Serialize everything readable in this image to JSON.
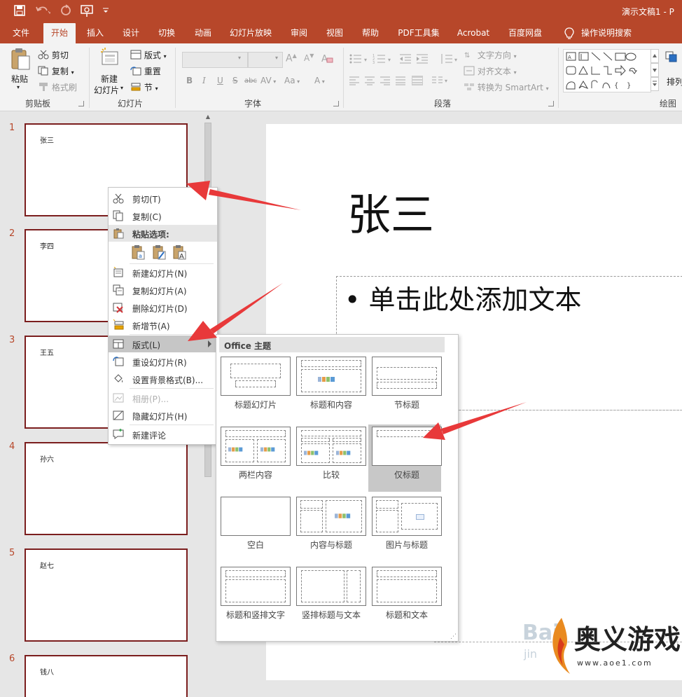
{
  "window": {
    "title": "演示文稿1 - P"
  },
  "tabs": [
    {
      "label": "文件"
    },
    {
      "label": "开始",
      "active": true
    },
    {
      "label": "插入"
    },
    {
      "label": "设计"
    },
    {
      "label": "切换"
    },
    {
      "label": "动画"
    },
    {
      "label": "幻灯片放映"
    },
    {
      "label": "审阅"
    },
    {
      "label": "视图"
    },
    {
      "label": "帮助"
    },
    {
      "label": "PDF工具集"
    },
    {
      "label": "Acrobat"
    },
    {
      "label": "百度网盘"
    },
    {
      "label": "操作说明搜索"
    }
  ],
  "ribbon": {
    "clipboard": {
      "paste": "粘贴",
      "cut": "剪切",
      "copy": "复制",
      "format_painter": "格式刷",
      "label": "剪贴板"
    },
    "slides": {
      "new_slide_1": "新建",
      "new_slide_2": "幻灯片",
      "layout": "版式",
      "reset": "重置",
      "section": "节",
      "label": "幻灯片"
    },
    "font": {
      "label": "字体",
      "bold": "B",
      "italic": "I",
      "underline": "U",
      "strike": "S",
      "abc": "abc",
      "spacing": "AV",
      "case": "Aa"
    },
    "paragraph": {
      "text_direction": "文字方向",
      "align_text": "对齐文本",
      "smartart": "转换为 SmartArt",
      "label": "段落"
    },
    "drawing": {
      "label": "绘图",
      "arrange": "排列"
    }
  },
  "slides": [
    {
      "num": "1",
      "title": "张三"
    },
    {
      "num": "2",
      "title": "李四"
    },
    {
      "num": "3",
      "title": "王五"
    },
    {
      "num": "4",
      "title": "孙六"
    },
    {
      "num": "5",
      "title": "赵七"
    },
    {
      "num": "6",
      "title": "钱八"
    }
  ],
  "editor": {
    "title": "张三",
    "body": "• 单击此处添加文本"
  },
  "context_menu": {
    "cut": "剪切(T)",
    "copy": "复制(C)",
    "paste_options": "粘贴选项:",
    "new_slide": "新建幻灯片(N)",
    "duplicate_slide": "复制幻灯片(A)",
    "delete_slide": "删除幻灯片(D)",
    "new_section": "新增节(A)",
    "layout": "版式(L)",
    "reset_slide": "重设幻灯片(R)",
    "format_background": "设置背景格式(B)...",
    "photo_album": "相册(P)...",
    "hide_slide": "隐藏幻灯片(H)",
    "new_comment": "新建评论"
  },
  "layout_gallery": {
    "header": "Office 主题",
    "items": [
      {
        "name": "标题幻灯片"
      },
      {
        "name": "标题和内容"
      },
      {
        "name": "节标题"
      },
      {
        "name": "两栏内容"
      },
      {
        "name": "比较"
      },
      {
        "name": "仅标题",
        "selected": true
      },
      {
        "name": "空白"
      },
      {
        "name": "内容与标题"
      },
      {
        "name": "图片与标题"
      },
      {
        "name": "标题和竖排文字"
      },
      {
        "name": "竖排标题与文本"
      },
      {
        "name": "标题和文本"
      }
    ]
  },
  "watermark": {
    "text": "奥义游戏网",
    "url": "www.aoe1.com",
    "left_mark": "Bai",
    "left_sub": "jin"
  },
  "colors": {
    "accent": "#b7472a",
    "thumb_border": "#7b1e1e",
    "arrow": "#e8393a"
  }
}
